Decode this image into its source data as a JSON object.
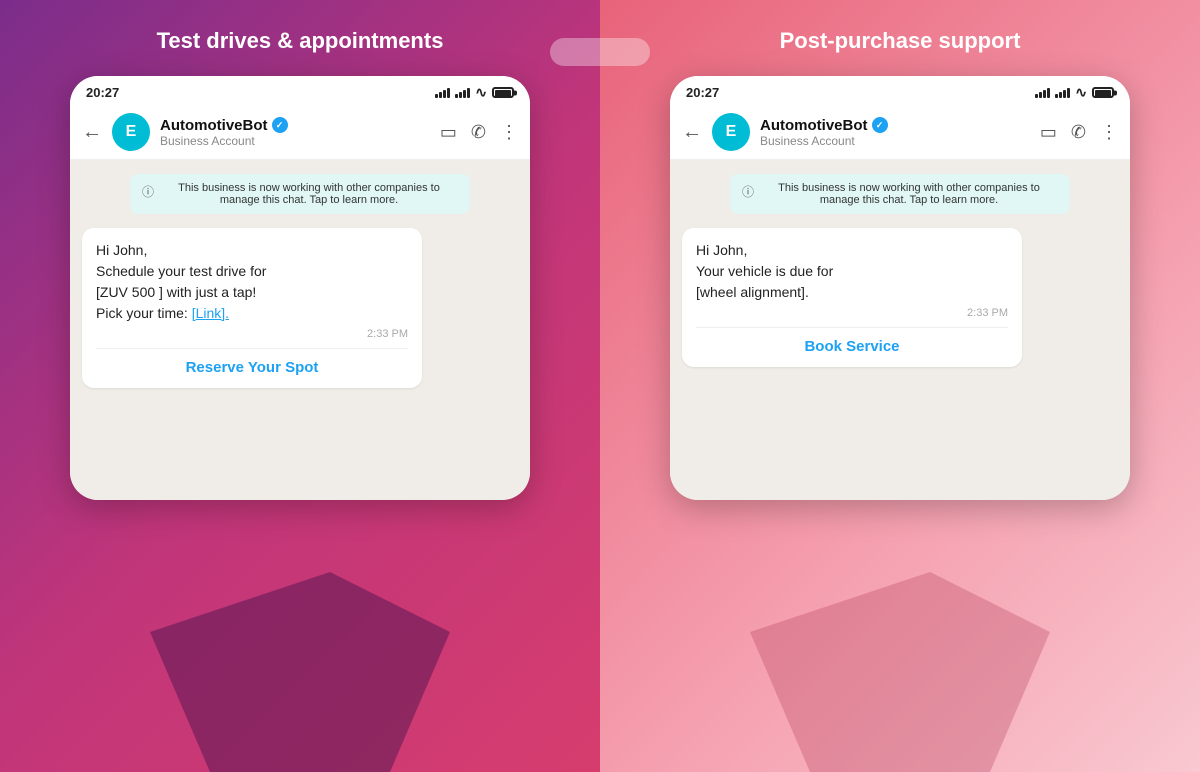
{
  "left": {
    "title": "Test drives & appointments",
    "phone": {
      "status_time": "20:27",
      "bot_name": "AutomotiveBot",
      "bot_subtitle": "Business Account",
      "notice_text": "This business is now working with other companies to manage this chat. Tap to learn more.",
      "message_line1": "Hi John,",
      "message_line2": "Schedule your test drive for",
      "message_line3": "[ZUV 500 ] with just a tap!",
      "message_line4": "Pick your time:",
      "message_link": "[Link].",
      "message_time": "2:33 PM",
      "cta_label": "Reserve Your Spot"
    }
  },
  "right": {
    "title": "Post-purchase support",
    "phone": {
      "status_time": "20:27",
      "bot_name": "AutomotiveBot",
      "bot_subtitle": "Business Account",
      "notice_text": "This business is now working with other companies to manage this chat. Tap to learn more.",
      "message_line1": "Hi John,",
      "message_line2": "Your vehicle is due for",
      "message_line3": "[wheel alignment].",
      "message_time": "2:33 PM",
      "cta_label": "Book Service"
    }
  },
  "icons": {
    "back": "←",
    "avatar_letter": "E",
    "verified": "✓",
    "video": "▭",
    "phone": "✆",
    "more": "⋮",
    "info": "ⓘ"
  }
}
